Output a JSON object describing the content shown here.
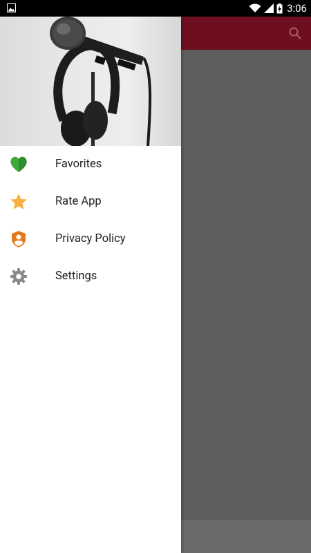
{
  "status_bar": {
    "time": "3:06"
  },
  "drawer": {
    "items": [
      {
        "label": "Favorites",
        "icon": "heart-icon",
        "color": "#3cab3c"
      },
      {
        "label": "Rate App",
        "icon": "star-icon",
        "color": "#f6b23e"
      },
      {
        "label": "Privacy Policy",
        "icon": "shield-user-icon",
        "color": "#e27a1d"
      },
      {
        "label": "Settings",
        "icon": "gear-icon",
        "color": "#8a8a8a"
      }
    ]
  },
  "colors": {
    "toolbar": "#6e0f1f",
    "scrim": "#5e5e5e",
    "drawer_bg": "#ffffff"
  }
}
